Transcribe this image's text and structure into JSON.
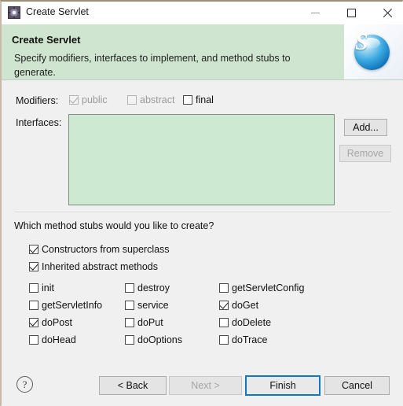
{
  "window": {
    "title": "Create Servlet",
    "icon": "gear-icon",
    "controls": {
      "minimize": "minimize-icon",
      "maximize": "maximize-icon",
      "close": "close-icon"
    }
  },
  "banner": {
    "title": "Create Servlet",
    "description": "Specify modifiers, interfaces to implement, and method stubs to generate.",
    "logo_letter": "S",
    "background_color": "#cfe5cf"
  },
  "form": {
    "modifiers_label": "Modifiers:",
    "modifiers": [
      {
        "label": "public",
        "checked": true,
        "enabled": false
      },
      {
        "label": "abstract",
        "checked": false,
        "enabled": false
      },
      {
        "label": "final",
        "checked": false,
        "enabled": true
      }
    ],
    "interfaces_label": "Interfaces:",
    "interfaces_items": [],
    "interfaces_bg": "#cde9d2",
    "add_label": "Add...",
    "remove_label": "Remove",
    "remove_enabled": false
  },
  "stubs": {
    "question": "Which method stubs would you like to create?",
    "constructors_label": "Constructors from superclass",
    "constructors_checked": true,
    "inherited_label": "Inherited abstract methods",
    "inherited_checked": true,
    "methods": [
      {
        "label": "init",
        "checked": false
      },
      {
        "label": "destroy",
        "checked": false
      },
      {
        "label": "getServletConfig",
        "checked": false
      },
      {
        "label": "getServletInfo",
        "checked": false
      },
      {
        "label": "service",
        "checked": false
      },
      {
        "label": "doGet",
        "checked": true
      },
      {
        "label": "doPost",
        "checked": true
      },
      {
        "label": "doPut",
        "checked": false
      },
      {
        "label": "doDelete",
        "checked": false
      },
      {
        "label": "doHead",
        "checked": false
      },
      {
        "label": "doOptions",
        "checked": false
      },
      {
        "label": "doTrace",
        "checked": false
      }
    ]
  },
  "footer": {
    "help_glyph": "?",
    "back_label": "< Back",
    "next_label": "Next >",
    "next_enabled": false,
    "finish_label": "Finish",
    "finish_focus_color": "#0d7ac0",
    "cancel_label": "Cancel"
  }
}
